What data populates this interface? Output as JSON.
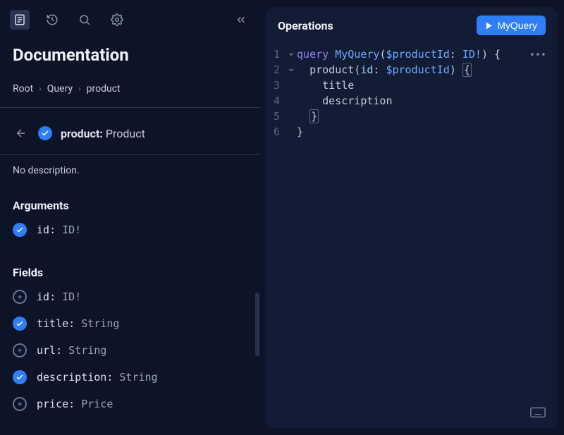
{
  "sidebar": {
    "title": "Documentation",
    "breadcrumb": [
      "Root",
      "Query",
      "product"
    ],
    "type_header": {
      "field": "product:",
      "type": "Product"
    },
    "no_description": "No description.",
    "sections": {
      "arguments": {
        "title": "Arguments"
      },
      "fields": {
        "title": "Fields"
      }
    },
    "arguments": [
      {
        "selected": true,
        "name": "id",
        "type": "ID!"
      }
    ],
    "fields": [
      {
        "selected": false,
        "name": "id",
        "type": "ID!"
      },
      {
        "selected": true,
        "name": "title",
        "type": "String"
      },
      {
        "selected": false,
        "name": "url",
        "type": "String"
      },
      {
        "selected": true,
        "name": "description",
        "type": "String"
      },
      {
        "selected": false,
        "name": "price",
        "type": "Price"
      }
    ]
  },
  "editor": {
    "title": "Operations",
    "run_label": "MyQuery",
    "code": {
      "keyword": "query",
      "op_name": "MyQuery",
      "var_name": "$productId",
      "var_type": "ID!",
      "root_field": "product",
      "arg_name": "id",
      "arg_value": "$productId",
      "sel1": "title",
      "sel2": "description"
    },
    "line_numbers": [
      "1",
      "2",
      "3",
      "4",
      "5",
      "6"
    ]
  }
}
